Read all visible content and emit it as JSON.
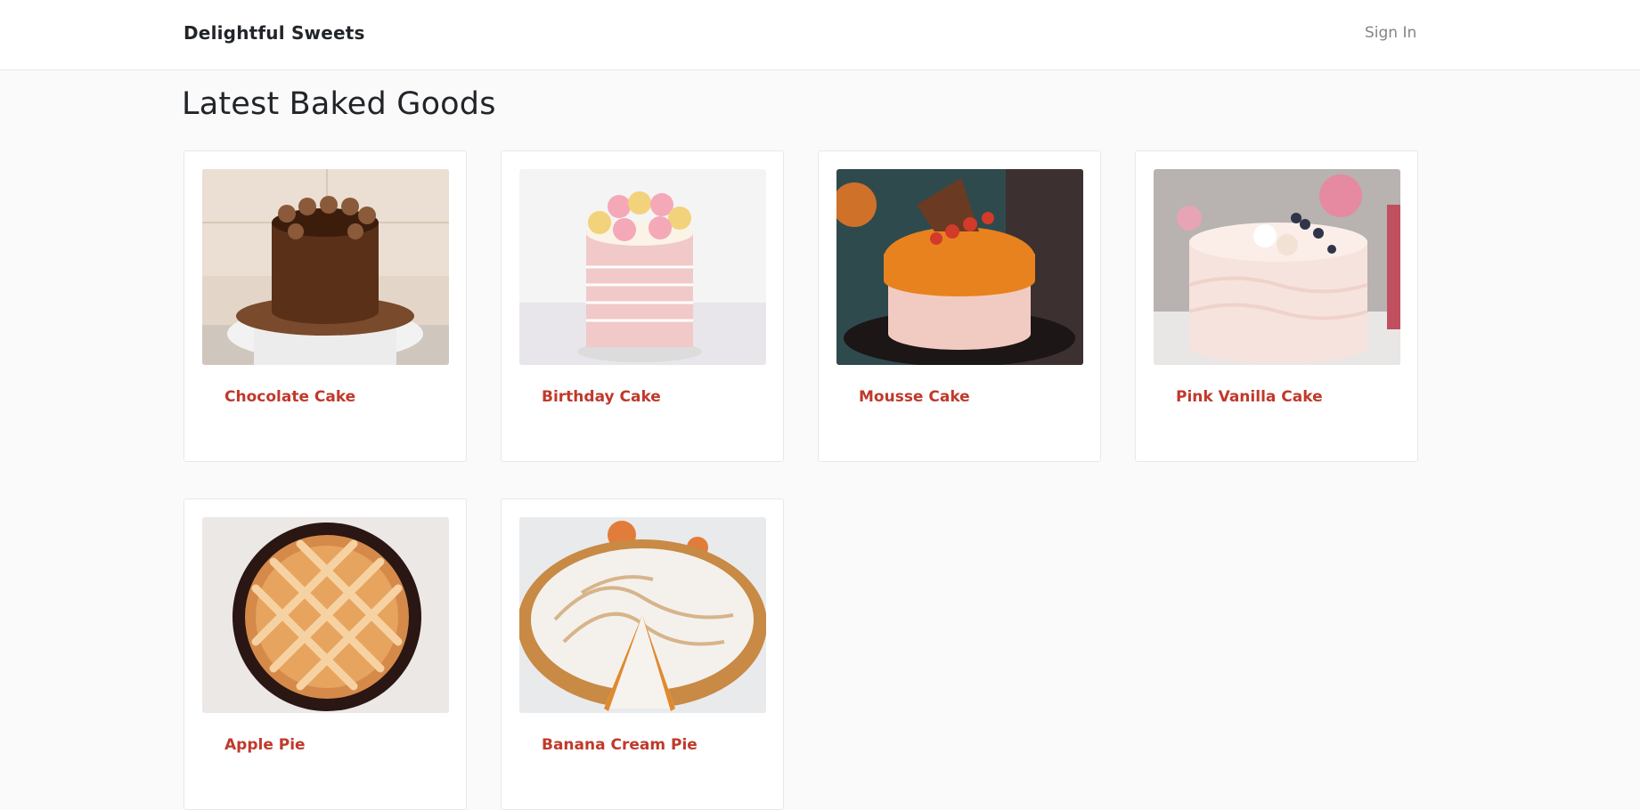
{
  "header": {
    "brand": "Delightful Sweets",
    "signin_label": "Sign In"
  },
  "main": {
    "title": "Latest Baked Goods",
    "items": [
      {
        "label": "Chocolate Cake"
      },
      {
        "label": "Birthday Cake"
      },
      {
        "label": "Mousse Cake"
      },
      {
        "label": "Pink Vanilla Cake"
      },
      {
        "label": "Apple Pie"
      },
      {
        "label": "Banana Cream Pie"
      }
    ]
  },
  "colors": {
    "accent": "#c0392b",
    "background": "#fafafa",
    "navbar": "#ffffff"
  }
}
